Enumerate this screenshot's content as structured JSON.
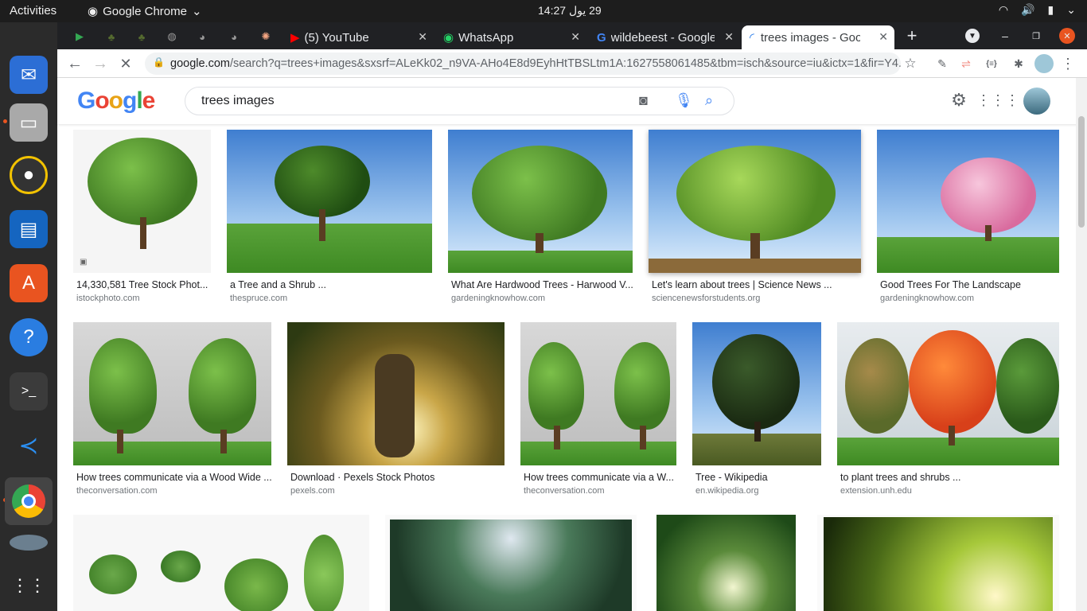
{
  "topbar": {
    "activities": "Activities",
    "app_name": "Google Chrome",
    "clock": "14:27 ‏29 يول"
  },
  "tabs": [
    {
      "label": "(5) YouTube"
    },
    {
      "label": "WhatsApp"
    },
    {
      "label": "wildebeest - Google"
    },
    {
      "label": "trees images - Goo"
    }
  ],
  "url": {
    "host": "google.com",
    "path": "/search?q=trees+images&sxsrf=ALeKk02_n9VA-AHo4E8d9EyhHtTBSLtm1A:1627558061485&tbm=isch&source=iu&ictx=1&fir=Y4..."
  },
  "search": {
    "logo": "Google",
    "query": "trees images"
  },
  "results": [
    {
      "caption": "14,330,581 Tree Stock Phot...",
      "source": "istockphoto.com"
    },
    {
      "caption": "a Tree and a Shrub ...",
      "source": "thespruce.com"
    },
    {
      "caption": "What Are Hardwood Trees - Harwood V...",
      "source": "gardeningknowhow.com"
    },
    {
      "caption": "Let's learn about trees | Science News ...",
      "source": "sciencenewsforstudents.org"
    },
    {
      "caption": "Good Trees For The Landscape",
      "source": "gardeningknowhow.com"
    },
    {
      "caption": "How trees communicate via a Wood Wide ...",
      "source": "theconversation.com"
    },
    {
      "caption": "Download · Pexels Stock Photos",
      "source": "pexels.com"
    },
    {
      "caption": "How trees communicate via a W...",
      "source": "theconversation.com"
    },
    {
      "caption": "Tree - Wikipedia",
      "source": "en.wikipedia.org"
    },
    {
      "caption": "to plant trees and shrubs ...",
      "source": "extension.unh.edu"
    }
  ],
  "colors": {
    "accent": "#1a73e8",
    "chrome_dark": "#202124"
  }
}
